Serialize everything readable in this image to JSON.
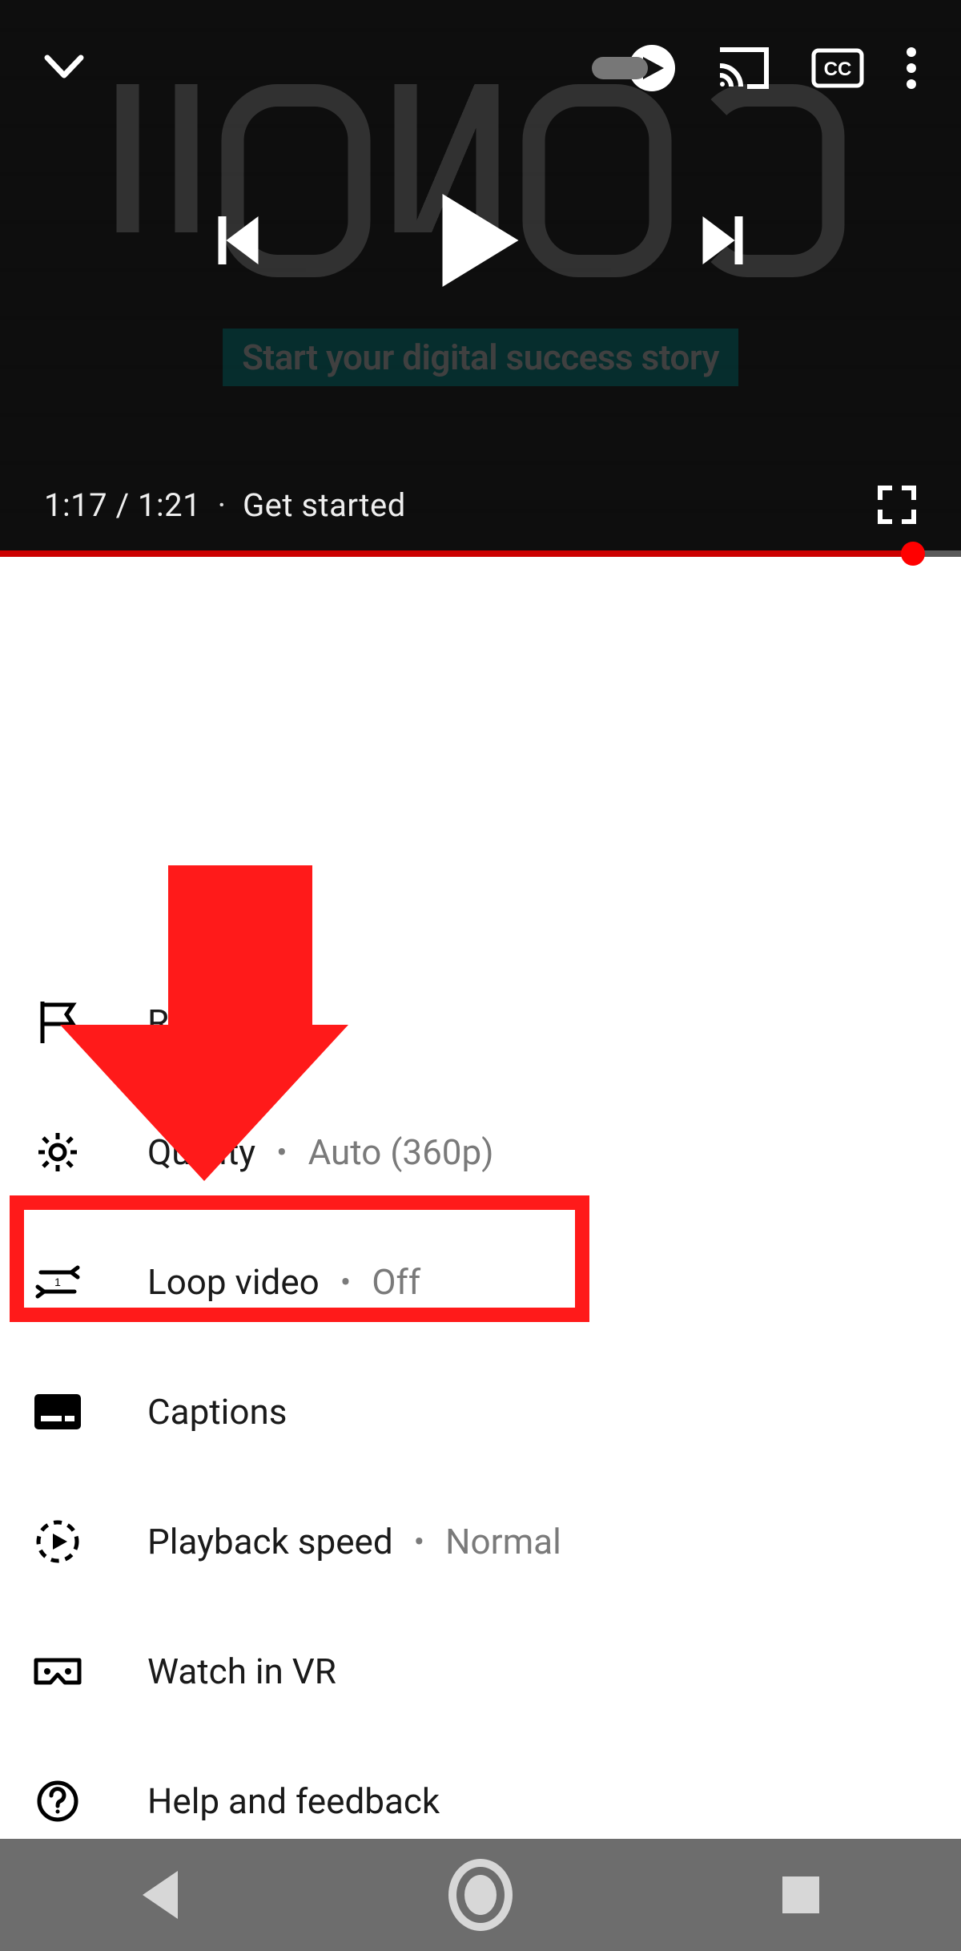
{
  "player": {
    "tagline": "Start your digital success story",
    "time_current": "1:17",
    "time_total": "1:21",
    "chapter_label": "Get started",
    "progress_percent": 95,
    "autoplay_on": false
  },
  "menu": {
    "items": [
      {
        "key": "report",
        "label": "Report",
        "value": null,
        "icon": "flag-icon"
      },
      {
        "key": "quality",
        "label": "Quality",
        "value": "Auto (360p)",
        "icon": "gear-icon"
      },
      {
        "key": "loop",
        "label": "Loop video",
        "value": "Off",
        "icon": "loop-icon"
      },
      {
        "key": "captions",
        "label": "Captions",
        "value": null,
        "icon": "captions-icon"
      },
      {
        "key": "speed",
        "label": "Playback speed",
        "value": "Normal",
        "icon": "speed-icon"
      },
      {
        "key": "vr",
        "label": "Watch in VR",
        "value": null,
        "icon": "vr-icon"
      },
      {
        "key": "help",
        "label": "Help and feedback",
        "value": null,
        "icon": "help-icon"
      }
    ],
    "highlighted_index": 2
  },
  "annotation": {
    "arrow_color": "#ff1a1a",
    "highlight_color": "#ff1a1a"
  }
}
